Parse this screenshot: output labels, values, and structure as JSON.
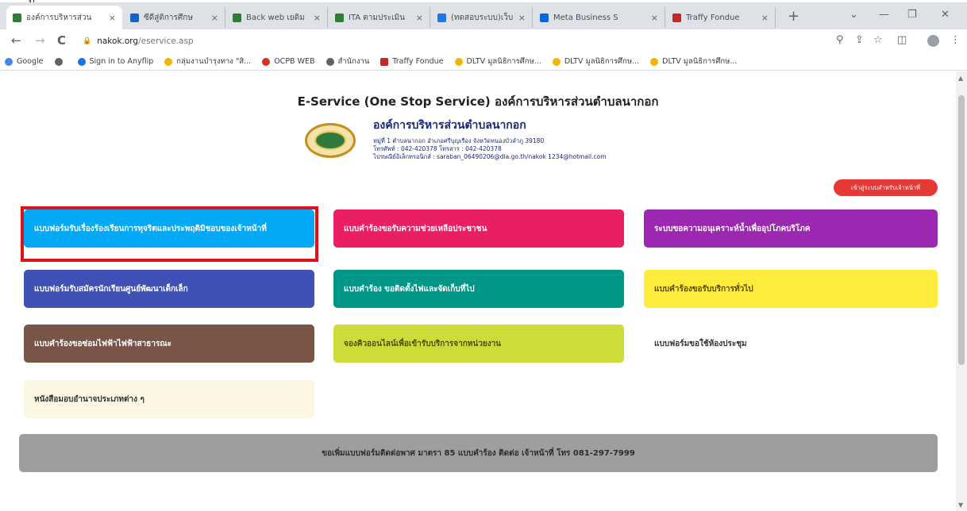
{
  "caption": "ป",
  "tabs": [
    {
      "title": "องค์การบริหารส่วน",
      "color": "#2e7d32",
      "active": true
    },
    {
      "title": "ซีดีสู่ติการศึกษ",
      "color": "#1565c0"
    },
    {
      "title": "Back web เยดิม",
      "color": "#2e7d32"
    },
    {
      "title": "ITA ตามประเมิน",
      "color": "#2e7d32"
    },
    {
      "title": "(ทดสอบระบบ)เว็บ",
      "color": "#1877f2"
    },
    {
      "title": "Meta Business S",
      "color": "#0668e1"
    },
    {
      "title": "Traffy Fondue",
      "color": "#c62828"
    }
  ],
  "tab_close_glyph": "×",
  "new_tab_glyph": "+",
  "window_controls": {
    "tabs_menu": "⌄",
    "minimize": "—",
    "maximize": "❐",
    "close": "✕"
  },
  "toolbar": {
    "back": "←",
    "forward": "→",
    "reload": "C",
    "host": "nakok.org",
    "path": "/eservice.asp",
    "icons": {
      "zoom": "⚲",
      "share": "⇪",
      "star": "☆",
      "sidebar": "◫",
      "menu": "⋮"
    }
  },
  "bookmarks": [
    {
      "label": "Google",
      "color": "#4285f4"
    },
    {
      "label": "",
      "color": "#5f6368"
    },
    {
      "label": "Sign in to Anyflip",
      "color": "#1a73e8"
    },
    {
      "label": "กลุ่มงานบำรุงทาง \"สิ...",
      "color": "#f4b400"
    },
    {
      "label": "OCPB WEB",
      "color": "#d93025"
    },
    {
      "label": "สำนักงาน",
      "color": "#5f6368"
    },
    {
      "label": "Traffy Fondue",
      "color": "#c62828"
    },
    {
      "label": "DLTV มูลนิธิการศึกษ...",
      "color": "#f4b400"
    },
    {
      "label": "DLTV มูลนิธิการศึกษ...",
      "color": "#f4b400"
    },
    {
      "label": "DLTV มูลนิธิการศึกษ...",
      "color": "#f4b400"
    }
  ],
  "page": {
    "title": "E-Service (One Stop Service) องค์การบริหารส่วนตำบลนากอก",
    "org_name": "องค์การบริหารส่วนตำบลนากอก",
    "address": "หมู่ที่ 1 ตำบลนากอก อำเภอศรีบุญเรือง จังหวัดหนองบัวลำภู 39180",
    "phone": "โทรศัพท์ : 042-420378 โทรสาร : 042-420378",
    "email": "ไปรษณีย์อิเล็กทรอนิกส์ : saraban_06490206@dla.go.th/nakok 1234@hotmail.com",
    "staff_button": "เข้าสู่ระบบสำหรับเจ้าหน้าที่",
    "cards": [
      {
        "label": "แบบฟอร์มรับเรื่องร้องเรียนการทุจริตและประพฤติมิชอบของเจ้าหน้าที่",
        "bg": "#03a9f4",
        "fg": "#ffffff",
        "highlighted": true
      },
      {
        "label": "แบบคำร้องขอรับความช่วยเหลือประชาชน",
        "bg": "#e91e63",
        "fg": "#ffffff"
      },
      {
        "label": "ระบบขอความอนุเคราะห์น้ำเพื่ออุปโภคบริโภค",
        "bg": "#9c27b0",
        "fg": "#ffffff"
      },
      {
        "label": "แบบฟอร์มรับสมัครนักเรียนศูนย์พัฒนาเด็กเล็ก",
        "bg": "#3f51b5",
        "fg": "#ffffff"
      },
      {
        "label": "แบบคำร้อง ขอติดตั้งไฟและจัดเก็บที่ไป",
        "bg": "#009688",
        "fg": "#ffffff"
      },
      {
        "label": "แบบคำร้องขอรับบริการทั่วไป",
        "bg": "#ffeb3b",
        "fg": "#5a4a00"
      },
      {
        "label": "แบบคำร้องขอซ่อมไฟฟ้าไฟฟ้าสาธารณะ",
        "bg": "#795548",
        "fg": "#ffffff"
      },
      {
        "label": "จองคิวออนไลน์เพื่อเข้ารับบริการจากหน่วยงาน",
        "bg": "#cddc39",
        "fg": "#4a5200"
      },
      {
        "label": "แบบฟอร์มขอใช้ห้องประชุม",
        "bg": "#ffffff",
        "fg": "#333333"
      },
      {
        "label": "หนังสือมอบอำนาจประเภทต่าง ๆ",
        "bg": "#fdf6e3",
        "fg": "#333333"
      }
    ],
    "footer": "ขอเพิ่มแบบฟอร์มติดต่อพาศ มาตรา 85 แบบคำร้อง ติดต่อ เจ้าหน้าที่ โทร 081-297-7999"
  }
}
